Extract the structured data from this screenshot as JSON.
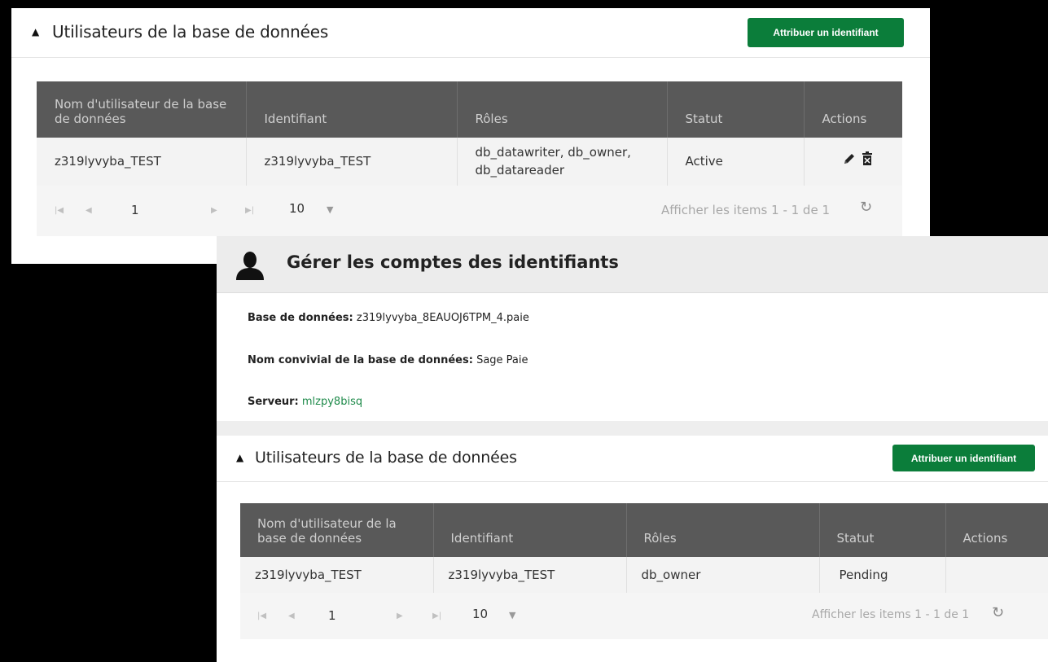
{
  "panel_top": {
    "section_title": "Utilisateurs de la base de données",
    "assign_button": "Attribuer un identifiant",
    "table": {
      "headers": [
        "Nom d'utilisateur de la base de données",
        "Identifiant",
        "Rôles",
        "Statut",
        "Actions"
      ],
      "rows": [
        {
          "db_user": "z319lyvyba_TEST",
          "login": "z319lyvyba_TEST",
          "roles": "db_datawriter, db_owner, db_datareader",
          "status": "Active"
        }
      ]
    },
    "pager": {
      "page": "1",
      "page_size": "10",
      "info": "Afficher les items 1 - 1 de 1"
    }
  },
  "manage": {
    "title": "Gérer les comptes des identifiants",
    "database_label": "Base de données:",
    "database_value": "z319lyvyba_8EAUOJ6TPM_4.paie",
    "friendly_label": "Nom convivial de la base de données:",
    "friendly_value": "Sage Paie",
    "server_label": "Serveur:",
    "server_value": "mlzpy8bisq"
  },
  "panel_bottom": {
    "section_title": "Utilisateurs de la base de données",
    "assign_button": "Attribuer un identifiant",
    "table": {
      "headers": [
        "Nom d'utilisateur de la base de données",
        "Identifiant",
        "Rôles",
        "Statut",
        "Actions"
      ],
      "rows": [
        {
          "db_user": "z319lyvyba_TEST",
          "login": "z319lyvyba_TEST",
          "roles": "db_owner",
          "status": "Pending"
        }
      ]
    },
    "pager": {
      "page": "1",
      "page_size": "10",
      "info": "Afficher les items 1 - 1 de 1"
    }
  },
  "colors": {
    "accent": "#0b7d3a",
    "header": "#595959",
    "link": "#1e8a4a"
  },
  "icons": [
    "caret-up-icon",
    "pencil-icon",
    "trash-icon",
    "first-page-icon",
    "prev-page-icon",
    "next-page-icon",
    "last-page-icon",
    "dropdown-arrow-icon",
    "refresh-icon",
    "user-icon"
  ]
}
